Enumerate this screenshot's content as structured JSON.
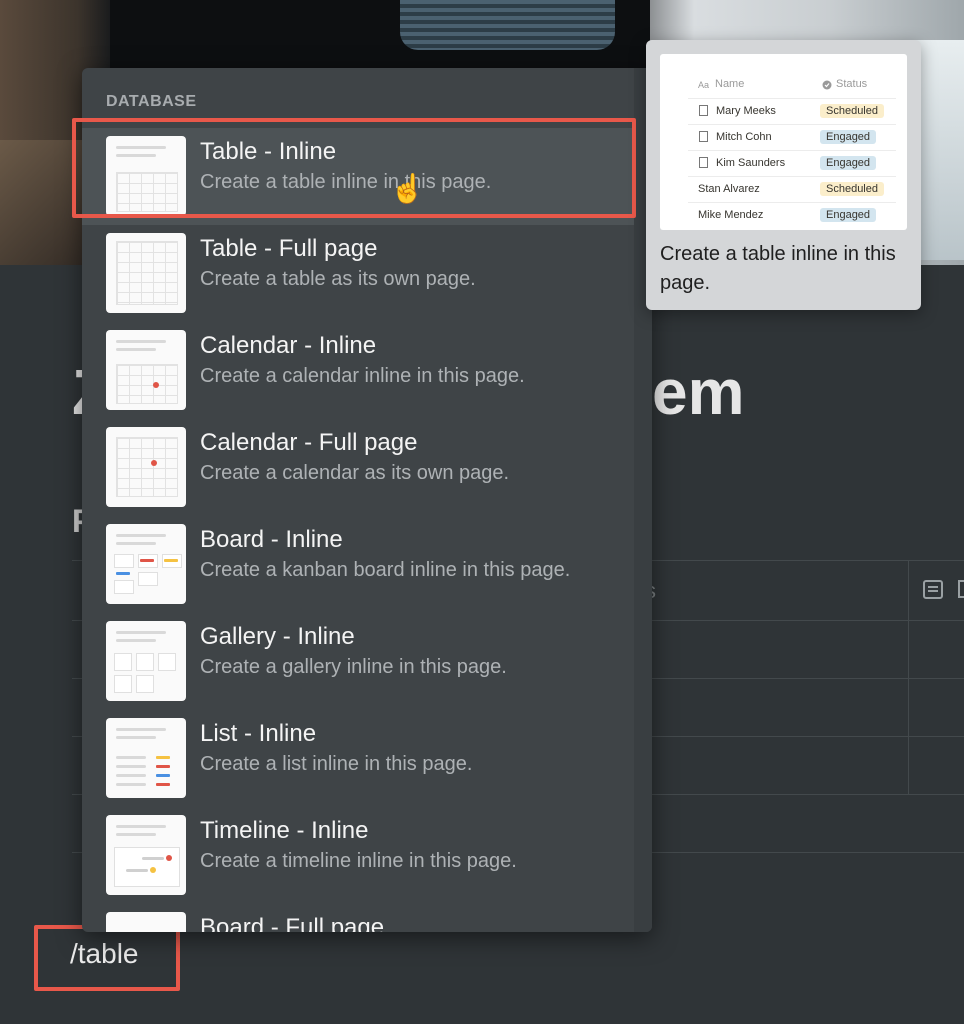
{
  "page": {
    "title_left": "Z",
    "title_right": "em",
    "subheading_letter": "P",
    "ghost_text": "s"
  },
  "command": {
    "text": "/table"
  },
  "menu": {
    "section": "DATABASE",
    "items": [
      {
        "title": "Table - Inline",
        "desc": "Create a table inline in this page.",
        "thumb": "table"
      },
      {
        "title": "Table - Full page",
        "desc": "Create a table as its own page.",
        "thumb": "table-full"
      },
      {
        "title": "Calendar - Inline",
        "desc": "Create a calendar inline in this page.",
        "thumb": "calendar"
      },
      {
        "title": "Calendar - Full page",
        "desc": "Create a calendar as its own page.",
        "thumb": "calendar-full"
      },
      {
        "title": "Board - Inline",
        "desc": "Create a kanban board inline in this page.",
        "thumb": "board"
      },
      {
        "title": "Gallery - Inline",
        "desc": "Create a gallery inline in this page.",
        "thumb": "gallery"
      },
      {
        "title": "List - Inline",
        "desc": "Create a list inline in this page.",
        "thumb": "list"
      },
      {
        "title": "Timeline - Inline",
        "desc": "Create a timeline inline in this page.",
        "thumb": "timeline"
      },
      {
        "title": "Board - Full page",
        "desc": "",
        "thumb": "board-full"
      }
    ],
    "selected_index": 0
  },
  "preview": {
    "col_name": "Name",
    "col_status": "Status",
    "rows": [
      {
        "name": "Mary Meeks",
        "status": "Scheduled",
        "icon": true
      },
      {
        "name": "Mitch Cohn",
        "status": "Engaged",
        "icon": true
      },
      {
        "name": "Kim Saunders",
        "status": "Engaged",
        "icon": true
      },
      {
        "name": "Stan Alvarez",
        "status": "Scheduled",
        "icon": false
      },
      {
        "name": "Mike Mendez",
        "status": "Engaged",
        "icon": false
      }
    ],
    "caption": "Create a table inline in this page."
  },
  "colors": {
    "background": "#2f3437",
    "menu": "#3f4447",
    "highlight": "#e8584a",
    "scheduled": "#fbeecb",
    "engaged": "#d3e5ef"
  }
}
